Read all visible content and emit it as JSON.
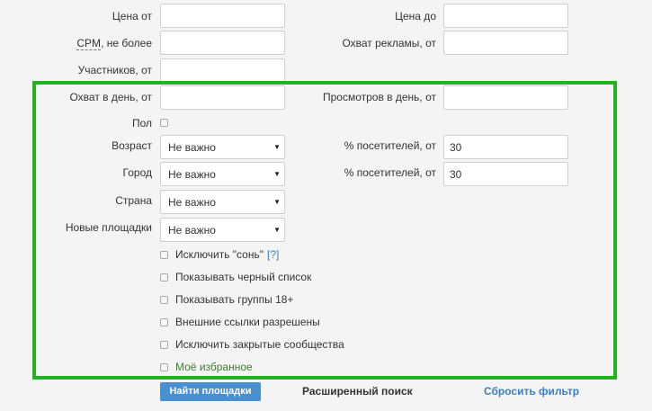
{
  "fields": {
    "price_from": {
      "label": "Цена от",
      "value": ""
    },
    "price_to": {
      "label": "Цена до",
      "value": ""
    },
    "cpm_abbr": "CPM",
    "cpm_suffix": ", не более",
    "cpm_value": "",
    "ad_reach_from": {
      "label": "Охват рекламы, от",
      "value": ""
    },
    "members_from": {
      "label": "Участников, от",
      "value": ""
    },
    "daily_reach_from": {
      "label": "Охват в день, от",
      "value": ""
    },
    "daily_views_from": {
      "label": "Просмотров в день, от",
      "value": ""
    },
    "gender": {
      "label": "Пол",
      "checked": false
    },
    "age": {
      "label": "Возраст",
      "selected": "Не важно"
    },
    "age_visitors_pct": {
      "label": "% посетителей, от",
      "value": "30"
    },
    "city": {
      "label": "Город",
      "selected": "Не важно"
    },
    "city_visitors_pct": {
      "label": "% посетителей, от",
      "value": "30"
    },
    "country": {
      "label": "Страна",
      "selected": "Не важно"
    },
    "new_sites": {
      "label": "Новые площадки",
      "selected": "Не важно"
    }
  },
  "checkboxes": {
    "exclude_sleepy": {
      "label": "Исключить \"сонь\"",
      "hint": "[?]",
      "checked": false
    },
    "show_blacklist": {
      "label": "Показывать черный список",
      "checked": false
    },
    "show_18plus": {
      "label": "Показывать группы 18+",
      "checked": false
    },
    "external_links": {
      "label": "Внешние ссылки разрешены",
      "checked": false
    },
    "exclude_closed": {
      "label": "Исключить закрытые сообщества",
      "checked": false
    },
    "my_favorites": {
      "label": "Моё избранное",
      "checked": false
    }
  },
  "actions": {
    "find_label": "Найти площадки",
    "advanced_label": "Расширенный поиск",
    "reset_label": "Сбросить фильтр"
  },
  "colors": {
    "highlight_frame": "#21b21f",
    "primary_button": "#4a8fcf",
    "link_blue": "#3a7fc1",
    "favorites_text": "#3f7d2d"
  }
}
